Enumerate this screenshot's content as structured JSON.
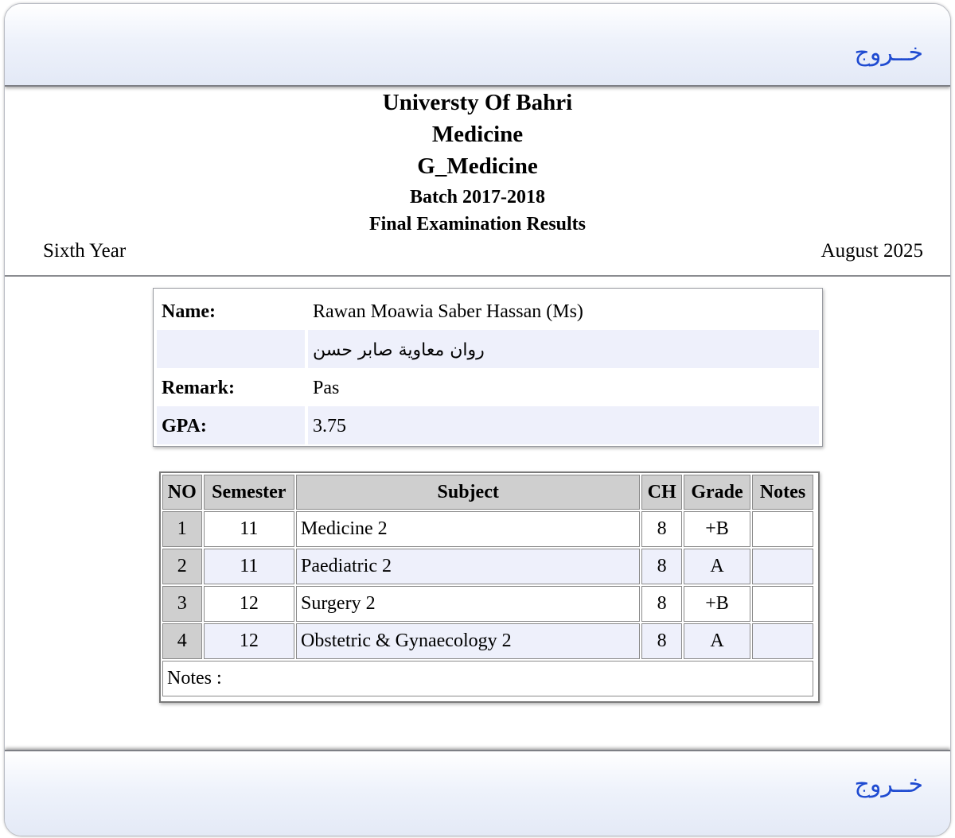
{
  "exit_label": "خــروج",
  "header": {
    "university": "Universty Of Bahri",
    "faculty": "Medicine",
    "department": "G_Medicine",
    "batch": "Batch 2017-2018",
    "title": "Final Examination Results",
    "year": "Sixth Year",
    "date": "August 2025"
  },
  "student": {
    "name_label": "Name:",
    "name": "Rawan Moawia Saber Hassan (Ms)",
    "name_arabic": "روان معاوية صابر حسن",
    "remark_label": "Remark:",
    "remark": "Pas",
    "gpa_label": "GPA:",
    "gpa": "3.75"
  },
  "grades_table": {
    "headers": [
      "NO",
      "Semester",
      "Subject",
      "CH",
      "Grade",
      "Notes"
    ],
    "rows": [
      {
        "no": "1",
        "semester": "11",
        "subject": "Medicine 2",
        "ch": "8",
        "grade": "+B",
        "notes": ""
      },
      {
        "no": "2",
        "semester": "11",
        "subject": "Paediatric 2",
        "ch": "8",
        "grade": "A",
        "notes": ""
      },
      {
        "no": "3",
        "semester": "12",
        "subject": "Surgery 2",
        "ch": "8",
        "grade": "+B",
        "notes": ""
      },
      {
        "no": "4",
        "semester": "12",
        "subject": "Obstetric & Gynaecology 2",
        "ch": "8",
        "grade": "A",
        "notes": ""
      }
    ],
    "notes_label": "Notes :"
  }
}
